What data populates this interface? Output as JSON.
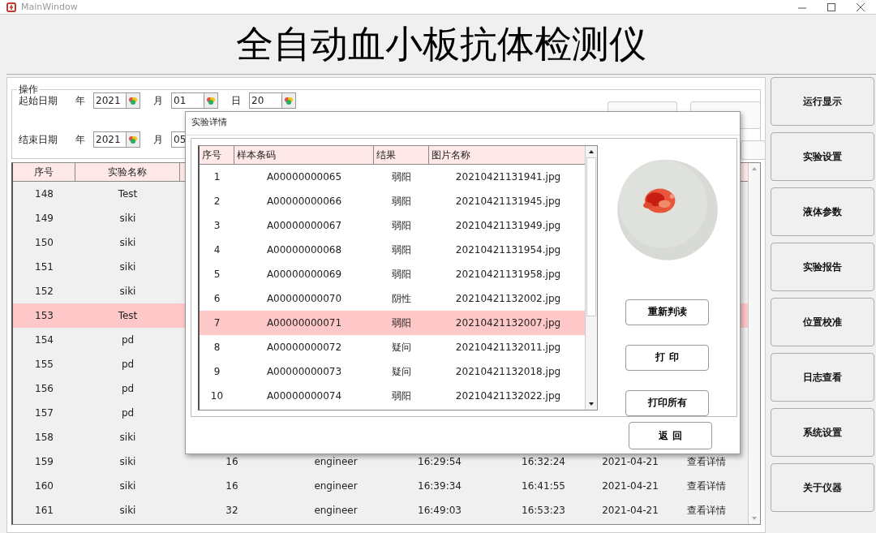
{
  "window": {
    "title": "MainWindow"
  },
  "header": {
    "title": "全自动血小板抗体检测仪"
  },
  "operations": {
    "title": "操作",
    "dates": [
      {
        "label": "起始日期",
        "fields": [
          {
            "unit": "年",
            "value": "2021"
          },
          {
            "unit": "月",
            "value": "01"
          },
          {
            "unit": "日",
            "value": "20"
          }
        ]
      },
      {
        "label": "结束日期",
        "fields": [
          {
            "unit": "年",
            "value": "2021"
          },
          {
            "unit": "月",
            "value": "05"
          }
        ]
      }
    ]
  },
  "records": {
    "columns": [
      "序号",
      "实验名称"
    ],
    "rows": [
      {
        "selected": false,
        "cells": [
          "148",
          "Test"
        ]
      },
      {
        "selected": false,
        "cells": [
          "149",
          "siki"
        ]
      },
      {
        "selected": false,
        "cells": [
          "150",
          "siki"
        ]
      },
      {
        "selected": false,
        "cells": [
          "151",
          "siki"
        ]
      },
      {
        "selected": false,
        "cells": [
          "152",
          "siki"
        ]
      },
      {
        "selected": true,
        "cells": [
          "153",
          "Test"
        ]
      },
      {
        "selected": false,
        "cells": [
          "154",
          "pd"
        ]
      },
      {
        "selected": false,
        "cells": [
          "155",
          "pd"
        ]
      },
      {
        "selected": false,
        "cells": [
          "156",
          "pd"
        ]
      },
      {
        "selected": false,
        "cells": [
          "157",
          "pd"
        ]
      },
      {
        "selected": false,
        "cells": [
          "158",
          "siki"
        ]
      },
      {
        "selected": false,
        "cells": [
          "159",
          "siki",
          "16",
          "engineer",
          "16:29:54",
          "16:32:24",
          "2021-04-21",
          "查看详情"
        ]
      },
      {
        "selected": false,
        "cells": [
          "160",
          "siki",
          "16",
          "engineer",
          "16:39:34",
          "16:41:55",
          "2021-04-21",
          "查看详情"
        ]
      },
      {
        "selected": false,
        "cells": [
          "161",
          "siki",
          "32",
          "engineer",
          "16:49:03",
          "16:53:23",
          "2021-04-21",
          "查看详情"
        ]
      }
    ]
  },
  "side_menu": [
    "运行显示",
    "实验设置",
    "液体参数",
    "实验报告",
    "位置校准",
    "日志查看",
    "系统设置",
    "关于仪器"
  ],
  "dialog": {
    "title": "实验详情",
    "columns": [
      "序号",
      "样本条码",
      "结果",
      "图片名称"
    ],
    "rows": [
      {
        "selected": false,
        "cells": [
          "1",
          "A00000000065",
          "弱阳",
          "20210421131941.jpg"
        ]
      },
      {
        "selected": false,
        "cells": [
          "2",
          "A00000000066",
          "弱阳",
          "20210421131945.jpg"
        ]
      },
      {
        "selected": false,
        "cells": [
          "3",
          "A00000000067",
          "弱阳",
          "20210421131949.jpg"
        ]
      },
      {
        "selected": false,
        "cells": [
          "4",
          "A00000000068",
          "弱阳",
          "20210421131954.jpg"
        ]
      },
      {
        "selected": false,
        "cells": [
          "5",
          "A00000000069",
          "弱阳",
          "20210421131958.jpg"
        ]
      },
      {
        "selected": false,
        "cells": [
          "6",
          "A00000000070",
          "阴性",
          "20210421132002.jpg"
        ]
      },
      {
        "selected": true,
        "cells": [
          "7",
          "A00000000071",
          "弱阳",
          "20210421132007.jpg"
        ]
      },
      {
        "selected": false,
        "cells": [
          "8",
          "A00000000072",
          "疑问",
          "20210421132011.jpg"
        ]
      },
      {
        "selected": false,
        "cells": [
          "9",
          "A00000000073",
          "疑问",
          "20210421132018.jpg"
        ]
      },
      {
        "selected": false,
        "cells": [
          "10",
          "A00000000074",
          "弱阳",
          "20210421132022.jpg"
        ]
      }
    ],
    "image": {
      "kind": "picture"
    },
    "actions": [
      "重新判读",
      "打 印",
      "打印所有"
    ],
    "close_button": "返 回"
  }
}
